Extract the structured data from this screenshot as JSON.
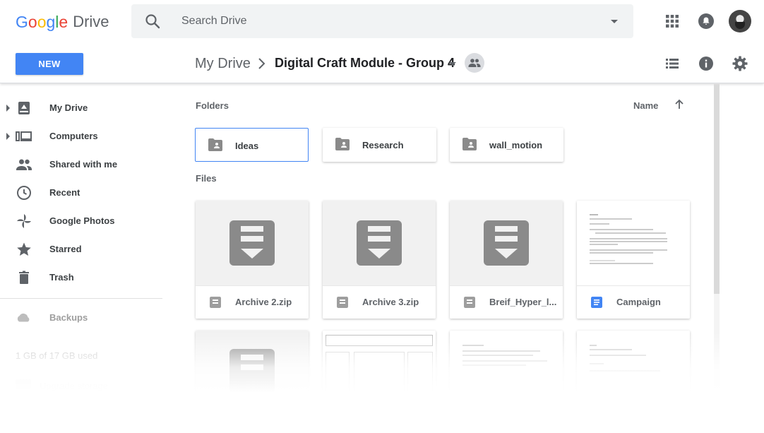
{
  "header": {
    "logo": {
      "google": [
        "G",
        "o",
        "o",
        "g",
        "l",
        "e"
      ],
      "google_colors": [
        "#4285f4",
        "#ea4335",
        "#fbbc05",
        "#4285f4",
        "#34a853",
        "#ea4335"
      ],
      "product": "Drive"
    },
    "search": {
      "placeholder": "Search Drive",
      "icon": "search-icon",
      "options_icon": "dropdown-arrow-icon"
    },
    "right_icons": [
      "apps-grid-icon",
      "notifications-bell-icon",
      "account-avatar"
    ]
  },
  "toolbar": {
    "new_label": "NEW",
    "new_color": "#4285f4",
    "breadcrumb": {
      "root": "My Drive",
      "current": "Digital Craft Module - Group 4"
    },
    "right_icons": [
      "list-view-icon",
      "info-icon",
      "settings-gear-icon"
    ]
  },
  "sidebar": {
    "items": [
      {
        "label": "My Drive",
        "icon": "my-drive-icon",
        "expandable": true
      },
      {
        "label": "Computers",
        "icon": "computers-icon",
        "expandable": true
      },
      {
        "label": "Shared with me",
        "icon": "shared-people-icon",
        "expandable": false
      },
      {
        "label": "Recent",
        "icon": "clock-icon",
        "expandable": false
      },
      {
        "label": "Google Photos",
        "icon": "pinwheel-icon",
        "expandable": false
      },
      {
        "label": "Starred",
        "icon": "star-icon",
        "expandable": false
      },
      {
        "label": "Trash",
        "icon": "trash-icon",
        "expandable": false
      }
    ],
    "backups_label": "Backups",
    "storage_text": "1 GB of 17 GB used",
    "upgrade_text": "Upgrade storage"
  },
  "main": {
    "folders_label": "Folders",
    "files_label": "Files",
    "sort": {
      "label": "Name",
      "direction_icon": "arrow-up-icon"
    },
    "folders": [
      {
        "name": "Ideas",
        "selected": true
      },
      {
        "name": "Research",
        "selected": false
      },
      {
        "name": "wall_motion",
        "selected": false
      }
    ],
    "files": [
      {
        "name": "Archive 2.zip",
        "type": "zip"
      },
      {
        "name": "Archive 3.zip",
        "type": "zip"
      },
      {
        "name": "Breif_Hyper_l...",
        "type": "zip"
      },
      {
        "name": "Campaign",
        "type": "doc"
      }
    ]
  }
}
